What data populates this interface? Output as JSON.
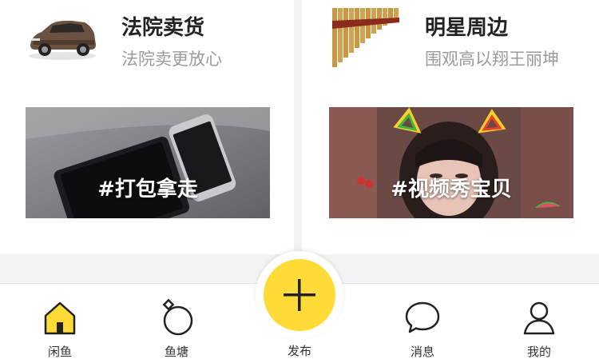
{
  "cards": [
    {
      "title": "法院卖货",
      "subtitle": "法院卖更放心",
      "thumb_icon": "suv-car-icon",
      "banner_label": "#打包拿走",
      "banner_image": "tablet-and-phone-photo"
    },
    {
      "title": "明星周边",
      "subtitle": "围观高以翔王丽坤",
      "thumb_icon": "pan-flute-icon",
      "banner_image": "girl-with-cat-ears-filter-photo",
      "banner_label": "#视频秀宝贝"
    }
  ],
  "tabbar": {
    "tabs": [
      {
        "label": "闲鱼",
        "icon": "home-icon"
      },
      {
        "label": "鱼塘",
        "icon": "pond-ring-icon"
      },
      {
        "label": "发布",
        "icon": "plus-icon"
      },
      {
        "label": "消息",
        "icon": "chat-bubble-icon"
      },
      {
        "label": "我的",
        "icon": "user-icon"
      }
    ]
  },
  "colors": {
    "accent": "#ffdb38",
    "background": "#f2f3f5",
    "title_text": "#222222",
    "subtitle_text": "#9a9a9a"
  }
}
